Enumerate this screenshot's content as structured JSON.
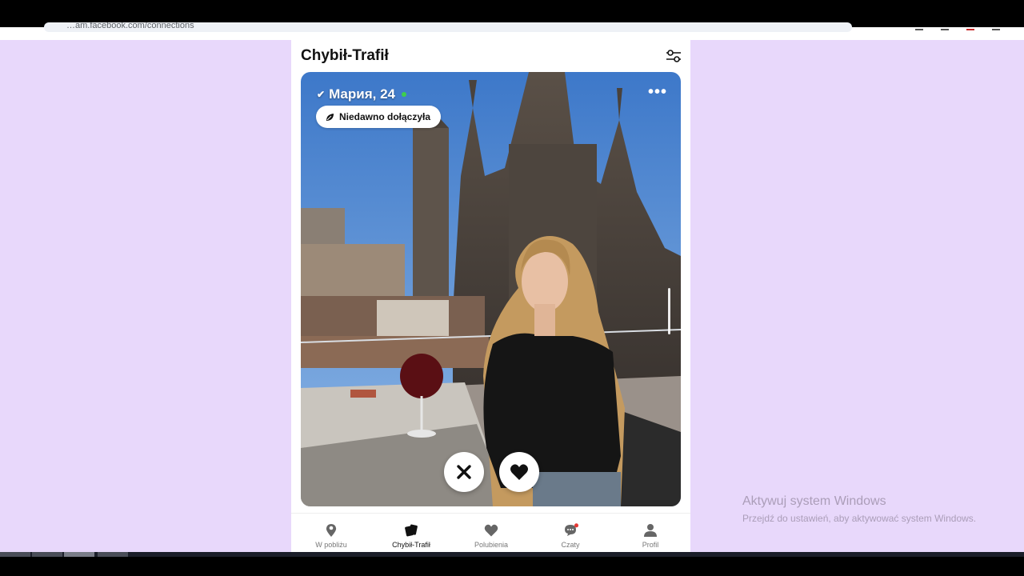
{
  "browser": {
    "url": "…am.facebook.com/connections"
  },
  "app": {
    "title": "Chybił-Trafił",
    "filter_icon": "sliders-icon"
  },
  "profile": {
    "name_age": "Мария, 24",
    "verified_icon": "check-icon",
    "online": true,
    "joined_badge": "Niedawno dołączyła",
    "joined_icon": "leaf-icon",
    "more_icon": "ellipsis-icon"
  },
  "actions": {
    "dislike_icon": "close-icon",
    "like_icon": "heart-icon"
  },
  "nav": {
    "items": [
      {
        "label": "W pobliżu",
        "icon": "location-pin-icon",
        "active": false
      },
      {
        "label": "Chybił-Trafił",
        "icon": "cards-icon",
        "active": true
      },
      {
        "label": "Polubienia",
        "icon": "heart-icon",
        "active": false
      },
      {
        "label": "Czaty",
        "icon": "chat-icon",
        "active": false,
        "badge": true
      },
      {
        "label": "Profil",
        "icon": "person-icon",
        "active": false
      }
    ]
  },
  "os": {
    "watermark_title": "Aktywuj system Windows",
    "watermark_subtitle": "Przejdź do ustawień, aby aktywować system Windows."
  },
  "colors": {
    "background": "#e8d8fb",
    "online": "#3ecf4c",
    "badge": "#e53935"
  }
}
